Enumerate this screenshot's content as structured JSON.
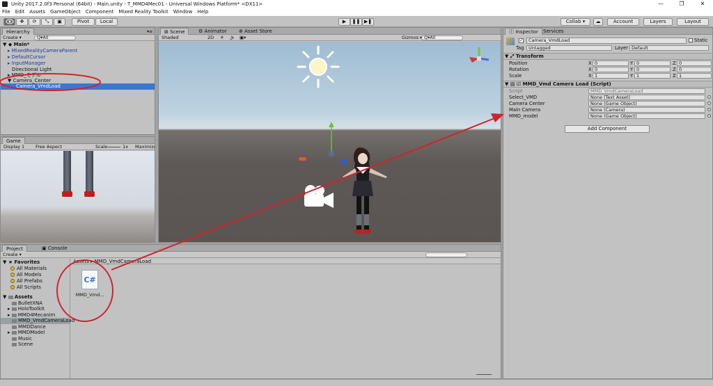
{
  "window": {
    "title": "Unity 2017.2.0f3 Personal (64bit) - Main.unity - T_MMD4Mec01 - Universal Windows Platform* <DX11>",
    "min": "—",
    "max": "❐",
    "close": "✕"
  },
  "menu": [
    "File",
    "Edit",
    "Assets",
    "GameObject",
    "Component",
    "Mixed Reality Toolkit",
    "Window",
    "Help"
  ],
  "toolbar": {
    "pivot": "Pivot",
    "local": "Local",
    "collab": "Collab ▾",
    "account": "Account",
    "layers": "Layers",
    "layout": "Layout",
    "cloud": "☁",
    "play": "▶",
    "pause": "❚❚",
    "step": "▶❚"
  },
  "hierarchy": {
    "tab": "Hierarchy",
    "create": "Create ▾",
    "search": "Q▾All",
    "scene": "Main*",
    "items": [
      "MixedRealityCameraParent",
      "DefaultCursor",
      "InputManager",
      "Directional Light",
      "MMD_モデル",
      "Camera_Center",
      "Camera_VmdLoad"
    ]
  },
  "scene": {
    "tab": "Scene",
    "animator_tab": "Animator",
    "asset_store_tab": "Asset Store",
    "shading": "Shaded",
    "mode2d": "2D",
    "gizmos": "Gizmos ▾",
    "search": "Q▾All"
  },
  "game": {
    "tab": "Game",
    "display": "Display 1",
    "aspect": "Free Aspect",
    "scale_label": "Scale",
    "scale_val": "1x",
    "maximize": "Maximize O"
  },
  "project": {
    "tab": "Project",
    "console_tab": "Console",
    "create": "Create ▾",
    "favorites_label": "Favorites",
    "favorites": [
      "All Materials",
      "All Models",
      "All Prefabs",
      "All Scripts"
    ],
    "assets_label": "Assets",
    "folders": [
      "BulletXNA",
      "HoloToolkit",
      "MMD4Mecanim",
      "MMD_VmdCameraLoad",
      "MMDDance",
      "MMDModel",
      "Music",
      "Scene"
    ],
    "breadcrumb_root": "Assets ▸",
    "breadcrumb_folder": "MMD_VmdCameraLoad",
    "file_name": "MMD_Vmd...",
    "file_icon": "C#"
  },
  "inspector": {
    "tab": "Inspector",
    "services_tab": "Services",
    "object_name": "Camera_VmdLoad",
    "static_label": "Static",
    "tag_label": "Tag",
    "tag_value": "Untagged",
    "layer_label": "Layer",
    "layer_value": "Default",
    "transform_title": "Transform",
    "rows": [
      {
        "label": "Position",
        "x": "0",
        "y": "0",
        "z": "0"
      },
      {
        "label": "Rotation",
        "x": "0",
        "y": "0",
        "z": "0"
      },
      {
        "label": "Scale",
        "x": "1",
        "y": "1",
        "z": "1"
      }
    ],
    "axis": {
      "x": "X",
      "y": "Y",
      "z": "Z"
    },
    "script_title": "MMD_Vmd Camera Load (Script)",
    "script_label": "Script",
    "script_value": "MMD_VmdCameraLoad",
    "fields": [
      {
        "label": "Select_VMD",
        "value": "None (Text Asset)"
      },
      {
        "label": "Camera Center",
        "value": "None (Game Object)"
      },
      {
        "label": "Main Camera",
        "value": "None (Camera)"
      },
      {
        "label": "MMD_model",
        "value": "None (Game Object)"
      }
    ],
    "add_component": "Add Component"
  },
  "colors": {
    "annotation": "#d2232a",
    "selection": "#3d76cf",
    "sky": "#a9c6d9",
    "ground": "#5e5956"
  }
}
